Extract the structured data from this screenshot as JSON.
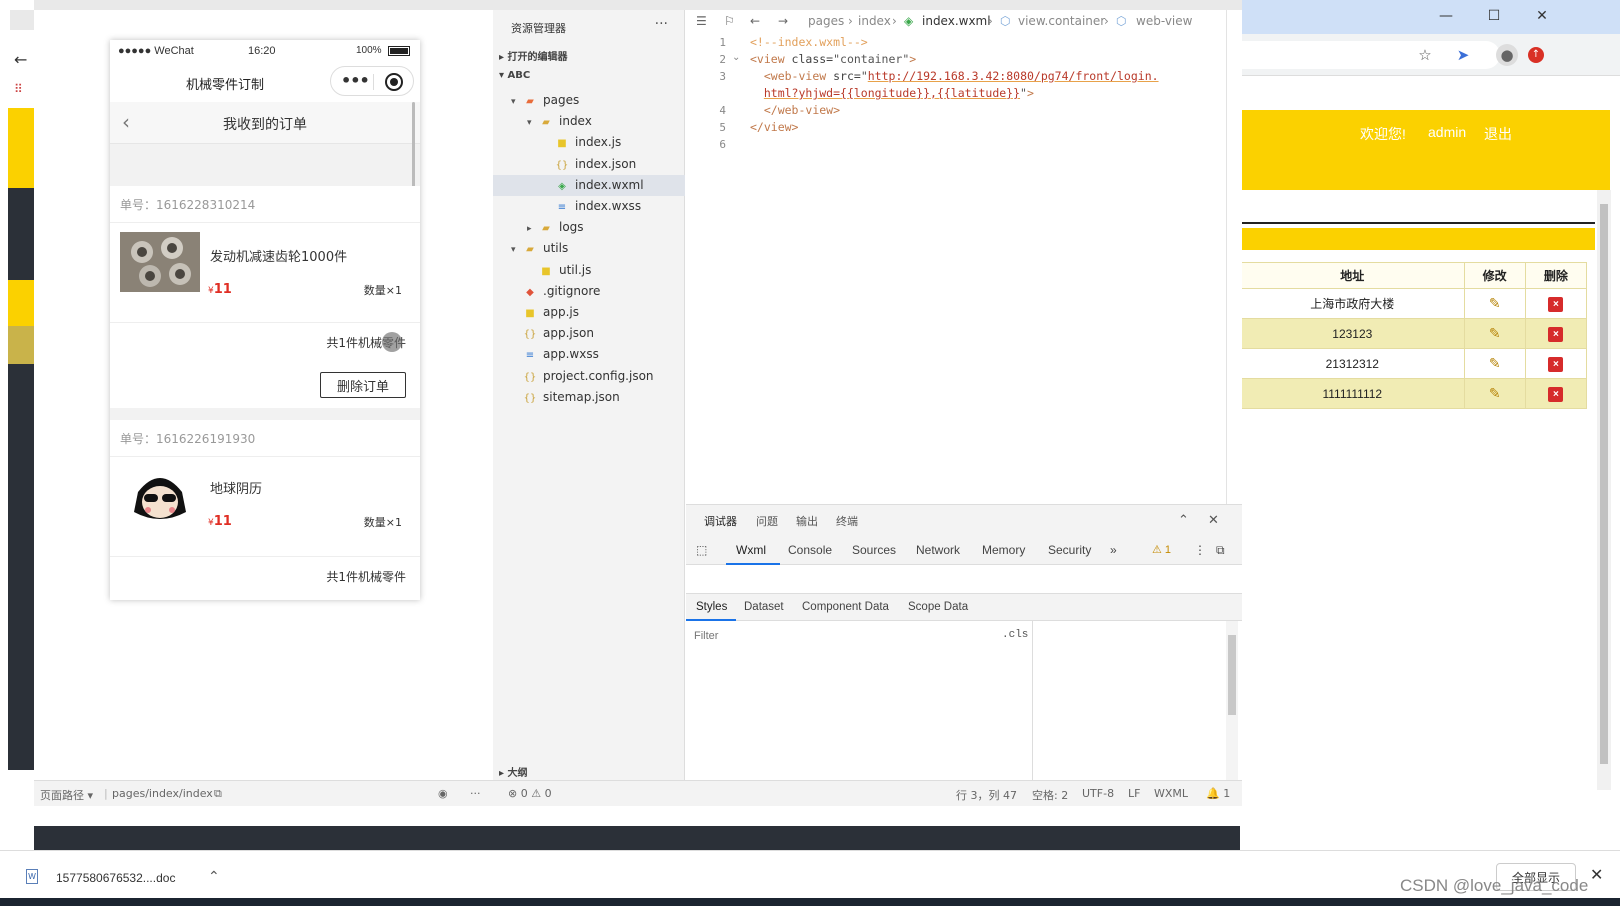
{
  "browser": {
    "window_controls": [
      "—",
      "☐",
      "✕"
    ],
    "header_links": [
      "欢迎您!",
      "admin",
      "退出"
    ],
    "table": {
      "headers": [
        "地址",
        "修改",
        "删除"
      ],
      "rows": [
        "上海市政府大楼",
        "123123",
        "21312312",
        "1111111112"
      ]
    },
    "colors": {
      "accent": "#fbd100",
      "row_alt": "#f1ecb4",
      "delete": "#d62b2b"
    }
  },
  "simulator": {
    "status_bar": {
      "carrier": "●●●●● WeChat",
      "time": "16:20",
      "battery": "100%"
    },
    "nav_title": "机械零件订制",
    "page_title": "我收到的订单",
    "back_icon": "‹",
    "orders": [
      {
        "number": "单号：1616228310214",
        "product": "发动机减速齿轮1000件",
        "currency": "¥",
        "price": "11",
        "qty": "数量×1",
        "total": "共1件机械零件",
        "delete_label": "删除订单"
      },
      {
        "number": "单号：1616226191930",
        "product": "地球阴历",
        "currency": "¥",
        "price": "11",
        "qty": "数量×1",
        "total": "共1件机械零件"
      }
    ],
    "footer": {
      "path_label": "页面路径 ▾",
      "path": "pages/index/index"
    }
  },
  "explorer": {
    "title": "资源管理器",
    "more": "···",
    "open_editors": "▸ 打开的编辑器",
    "project": "▾ ABC",
    "outline": "▸ 大纲",
    "tree": [
      {
        "label": "pages",
        "icon": "▰",
        "kind": "pages",
        "arrow": "▾"
      },
      {
        "label": "index",
        "icon": "▰",
        "kind": "folder",
        "arrow": "▾"
      },
      {
        "label": "index.js",
        "icon": "■",
        "kind": "js",
        "arrow": ""
      },
      {
        "label": "index.json",
        "icon": "{}",
        "kind": "json",
        "arrow": ""
      },
      {
        "label": "index.wxml",
        "icon": "◈",
        "kind": "wxml",
        "arrow": ""
      },
      {
        "label": "index.wxss",
        "icon": "≡",
        "kind": "wxss",
        "arrow": ""
      },
      {
        "label": "logs",
        "icon": "▰",
        "kind": "folder",
        "arrow": "▸"
      },
      {
        "label": "utils",
        "icon": "▰",
        "kind": "folder",
        "arrow": "▾"
      },
      {
        "label": "util.js",
        "icon": "■",
        "kind": "js",
        "arrow": ""
      },
      {
        "label": ".gitignore",
        "icon": "◆",
        "kind": "git",
        "arrow": ""
      },
      {
        "label": "app.js",
        "icon": "■",
        "kind": "js",
        "arrow": ""
      },
      {
        "label": "app.json",
        "icon": "{}",
        "kind": "json",
        "arrow": ""
      },
      {
        "label": "app.wxss",
        "icon": "≡",
        "kind": "wxss",
        "arrow": ""
      },
      {
        "label": "project.config.json",
        "icon": "{}",
        "kind": "json",
        "arrow": ""
      },
      {
        "label": "sitemap.json",
        "icon": "{}",
        "kind": "json",
        "arrow": ""
      }
    ],
    "selected": "index.wxml"
  },
  "editor": {
    "breadcrumb": [
      "pages",
      "index",
      "index.wxml",
      "view.container",
      "web-view"
    ],
    "lines": [
      {
        "n": "1",
        "parts": [
          [
            "com",
            "<!--index.wxml-->"
          ]
        ]
      },
      {
        "n": "2",
        "parts": [
          [
            "tag",
            "<view "
          ],
          [
            "attr",
            "class="
          ],
          [
            "plain",
            "\"container\""
          ],
          [
            "tag",
            ">"
          ]
        ]
      },
      {
        "n": "3",
        "parts": [
          [
            "plain",
            "  "
          ],
          [
            "tag",
            "<web-view "
          ],
          [
            "attr",
            "src="
          ],
          [
            "plain",
            "\""
          ],
          [
            "str",
            "http://192.168.3.42:8080/pg74/front/login."
          ]
        ]
      },
      {
        "n": "",
        "parts": [
          [
            "plain",
            "  "
          ],
          [
            "str",
            "html?yhjwd={{longitude}},{{latitude}}"
          ],
          [
            "plain",
            "\""
          ],
          [
            "tag",
            ">"
          ]
        ]
      },
      {
        "n": "4",
        "parts": [
          [
            "plain",
            "  "
          ],
          [
            "tag",
            "</web-view>"
          ]
        ]
      },
      {
        "n": "5",
        "parts": [
          [
            "tag",
            "</view>"
          ]
        ]
      },
      {
        "n": "6",
        "parts": []
      }
    ]
  },
  "debugger": {
    "top_tabs": [
      "调试器",
      "问题",
      "输出",
      "终端"
    ],
    "devtools_tabs": [
      "Wxml",
      "Console",
      "Sources",
      "Network",
      "Memory",
      "Security",
      "»"
    ],
    "warnings": "⚠ 1",
    "panel_tabs": [
      "Styles",
      "Dataset",
      "Component Data",
      "Scope Data"
    ],
    "filter_placeholder": "Filter",
    "cls": ".cls"
  },
  "status_bar": {
    "errors": "⊗ 0 ⚠ 0",
    "position": "行 3，列 47",
    "indent": "空格: 2",
    "encoding": "UTF-8",
    "eol": "LF",
    "language": "WXML",
    "bell": "🔔 1"
  },
  "download_bar": {
    "file_name": "1577580676532....doc",
    "show_all": "全部显示",
    "close": "✕"
  },
  "watermark": "CSDN @love_java_code"
}
